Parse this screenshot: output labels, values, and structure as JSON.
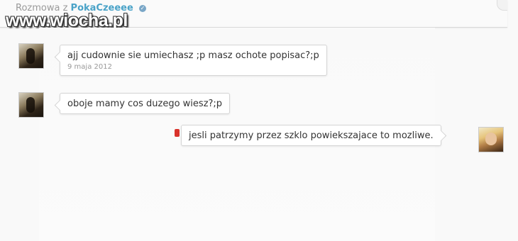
{
  "header": {
    "title_prefix": "Rozmowa z",
    "username": "PokaCzeeee",
    "verified_icon": "check-circle-icon"
  },
  "watermark": "www.wiocha.pl",
  "messages": [
    {
      "sender": "other",
      "text": "ajj cudownie sie umiechasz ;p masz ochote popisac?;p",
      "time": "9 maja 2012"
    },
    {
      "sender": "other",
      "text": "oboje mamy cos duzego wiesz?;p"
    },
    {
      "sender": "me",
      "text": "jesli patrzymy przez szklo powiekszajace to mozliwe."
    }
  ],
  "colors": {
    "username": "#4aa3c8",
    "unread_marker": "#d9322b",
    "background": "#f9f9f9"
  }
}
